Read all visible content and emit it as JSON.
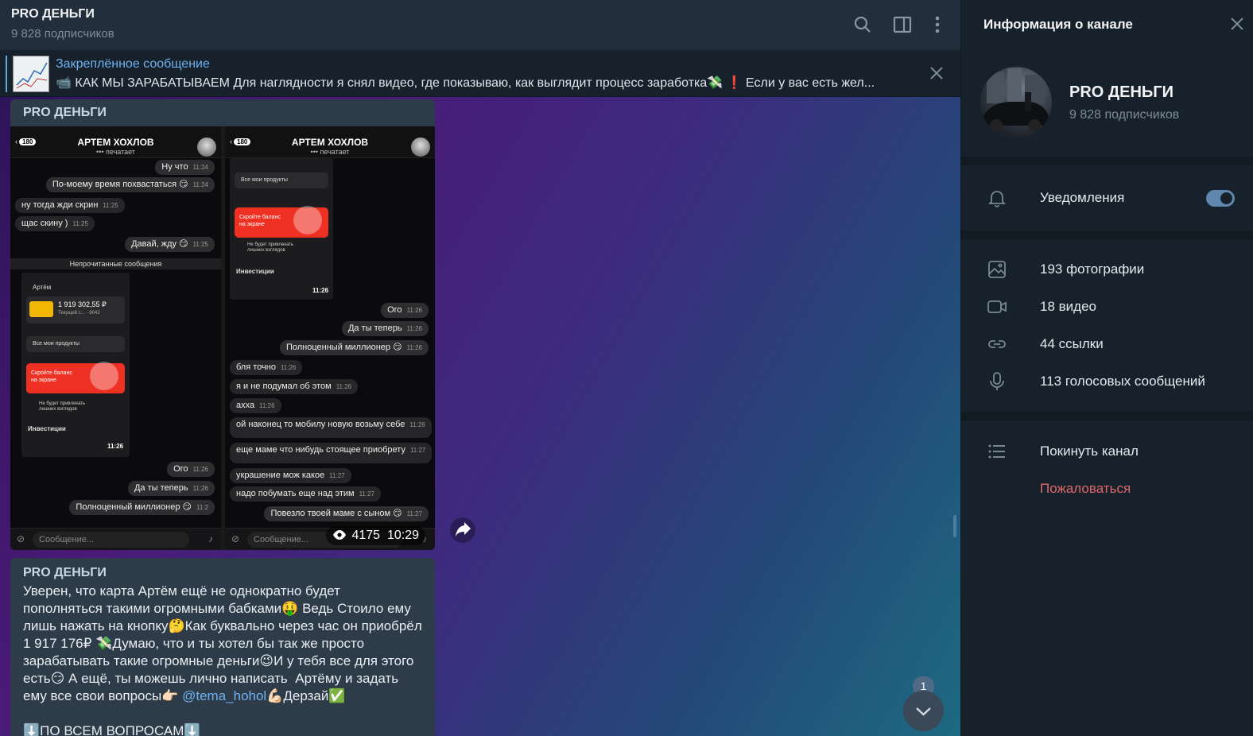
{
  "header": {
    "title": "PRO ДЕНЬГИ",
    "subscribers": "9 828 подписчиков"
  },
  "pinned": {
    "label": "Закреплённое сообщение",
    "text": "📹 КАК МЫ ЗАРАБАТЫВАЕМ  Для наглядности я снял видео, где показываю, как выглядит процесс заработка💸  ❗️ Если у вас есть жел..."
  },
  "media_post": {
    "author": "PRO ДЕНЬГИ",
    "views": "4175",
    "time": "10:29",
    "phone_left": {
      "back_count": "180",
      "contact": "АРТЕМ ХОХЛОВ",
      "status": "••• печатает",
      "messages": [
        {
          "text": "Ну что",
          "time": "11:24"
        },
        {
          "text": "По-моему время похвастаться 😏",
          "time": "11:24"
        },
        {
          "text": "ну тогда жди скрин",
          "time": "11:25"
        },
        {
          "text": "щас скину )",
          "time": "11:25"
        },
        {
          "text": "Давай, жду 😏",
          "time": "11:25"
        }
      ],
      "unread_label": "Непрочитанные сообщения",
      "app": {
        "user": "Артём",
        "balance": "1 919 302,55 ₽",
        "account": "Текущий с... ··8042",
        "all_products": "Все мои продукты",
        "hide_balance": "Скройте баланс на экране",
        "hint": "Не будет привлекать лишних взглядов",
        "investments": "Инвестиции",
        "clock": "11:26"
      },
      "messages_after": [
        {
          "text": "Ого",
          "time": "11:26"
        },
        {
          "text": "Да ты теперь",
          "time": "11:26"
        },
        {
          "text": "Полноценный миллионер 😏",
          "time": "11:2"
        }
      ],
      "input_placeholder": "Сообщение..."
    },
    "phone_right": {
      "back_count": "180",
      "contact": "АРТЕМ ХОХЛОВ",
      "status": "••• печатает",
      "app": {
        "all_products": "Все мои продукты",
        "hide_balance": "Скройте баланс на экране",
        "hint": "Не будет привлекать лишних взглядов",
        "investments": "Инвестиции",
        "clock": "11:26"
      },
      "messages": [
        {
          "text": "Ого",
          "time": "11:26"
        },
        {
          "text": "Да ты теперь",
          "time": "11:26"
        },
        {
          "text": "Полноценный миллионер 😏",
          "time": "11:26"
        },
        {
          "text": "бля точно",
          "time": "11:26"
        },
        {
          "text": "я и не подумал об этом",
          "time": "11:26"
        },
        {
          "text": "ахха",
          "time": "11:26"
        },
        {
          "text": "ой наконец то мобилу новую возьму себе",
          "time": "11:26"
        },
        {
          "text": "еще маме что нибудь стоящее приобрету",
          "time": "11:27"
        },
        {
          "text": "украшение мож какое",
          "time": "11:27"
        },
        {
          "text": "надо побумать еще над этим",
          "time": "11:27"
        },
        {
          "text": "Повезло твоей маме с сыном 😏",
          "time": "11:27"
        }
      ],
      "input_placeholder": "Сообщение..."
    }
  },
  "text_post": {
    "author": "PRO ДЕНЬГИ",
    "body_1": "Уверен, что карта Артём ещё не однократно будет пополняться такими огромными бабками🤑 Ведь Стоило ему лишь нажать на кнопку🤔Как буквально через час он приобрёл 1 917 176₽ 💸Думаю, что и ты хотел бы так же просто зарабатывать такие огромные деньги😉И у тебя все для этого есть😏 А ещё, ты можешь лично написать  Артёму и задать ему все свои вопросы👉🏻 ",
    "mention": "@tema_hohol",
    "body_2": "💪🏻Дерзай✅",
    "body_3": "⬇️ПО ВСЕМ ВОПРОСАМ⬇️"
  },
  "unread_count": "1",
  "info_panel": {
    "title": "Информация о канале",
    "channel_name": "PRO ДЕНЬГИ",
    "subscribers": "9 828 подписчиков",
    "notifications": "Уведомления",
    "notifications_on": true,
    "photos": "193 фотографии",
    "videos": "18 видео",
    "links": "44 ссылки",
    "voice": "113 голосовых сообщений",
    "leave": "Покинуть канал",
    "report": "Пожаловаться"
  },
  "colors": {
    "accent": "#6fb2ef",
    "danger": "#e0686a",
    "panel": "#17212b",
    "header": "#232e3c",
    "bubble": "#2e3b49",
    "bank_red": "#ef3124"
  }
}
